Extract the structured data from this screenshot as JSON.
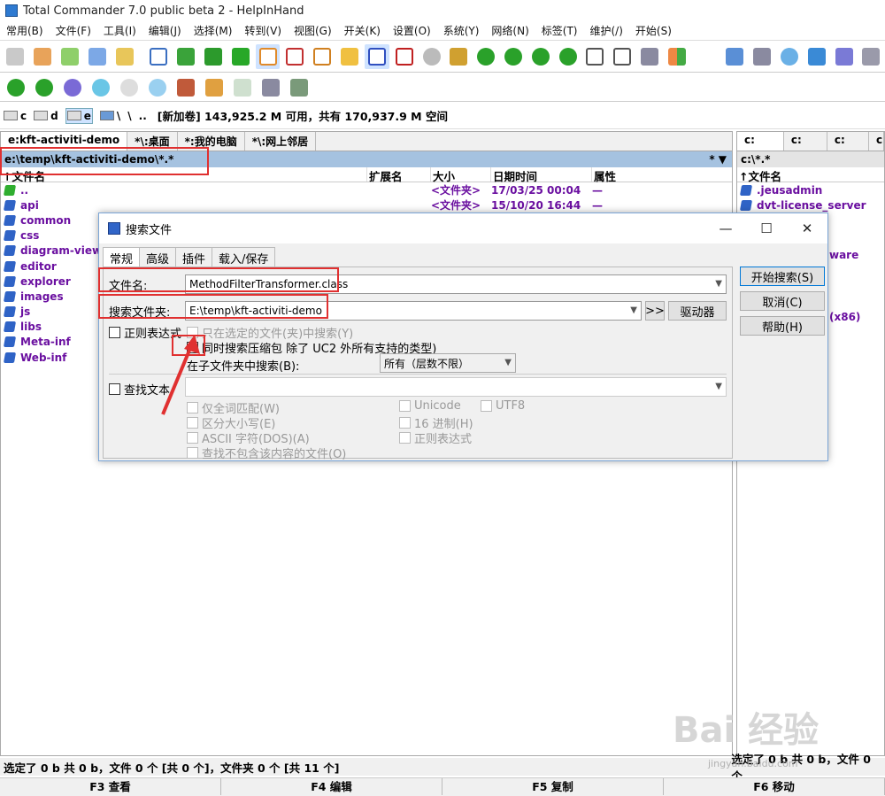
{
  "window": {
    "title": "Total Commander 7.0 public beta 2 - HelpInHand"
  },
  "menu": [
    "常用(B)",
    "文件(F)",
    "工具(I)",
    "编辑(J)",
    "选择(M)",
    "转到(V)",
    "视图(G)",
    "开关(K)",
    "设置(O)",
    "系统(Y)",
    "网络(N)",
    "标签(T)",
    "维护(/)",
    "开始(S)"
  ],
  "drivebar": {
    "drives": [
      "c",
      "d",
      "e"
    ],
    "extra": [
      "\\",
      "\\",
      ".."
    ],
    "volume_info": "[新加卷]  143,925.2 M 可用，共有 170,937.9 M 空间"
  },
  "left_panel": {
    "tabs": [
      "e:kft-activiti-demo",
      "*\\:桌面",
      "*:我的电脑",
      "*\\:网上邻居"
    ],
    "path": "e:\\temp\\kft-activiti-demo\\*.*",
    "path_right": "* ▼",
    "columns": [
      "↑文件名",
      "扩展名",
      "大小",
      "日期时间",
      "属性"
    ],
    "rows": [
      {
        "name": "..",
        "ext": "",
        "size": "<文件夹>",
        "date": "17/03/25 00:04",
        "attr": "—",
        "up": true
      },
      {
        "name": "api",
        "ext": "",
        "size": "<文件夹>",
        "date": "15/10/20 16:44",
        "attr": "—"
      },
      {
        "name": "common",
        "ext": "",
        "size": "",
        "date": "",
        "attr": ""
      },
      {
        "name": "css",
        "ext": "",
        "size": "",
        "date": "",
        "attr": ""
      },
      {
        "name": "diagram-viewe",
        "ext": "",
        "size": "",
        "date": "",
        "attr": ""
      },
      {
        "name": "editor",
        "ext": "",
        "size": "",
        "date": "",
        "attr": ""
      },
      {
        "name": "explorer",
        "ext": "",
        "size": "",
        "date": "",
        "attr": ""
      },
      {
        "name": "images",
        "ext": "",
        "size": "",
        "date": "",
        "attr": ""
      },
      {
        "name": "js",
        "ext": "",
        "size": "",
        "date": "",
        "attr": ""
      },
      {
        "name": "libs",
        "ext": "",
        "size": "",
        "date": "",
        "attr": ""
      },
      {
        "name": "Meta-inf",
        "ext": "",
        "size": "",
        "date": "",
        "attr": ""
      },
      {
        "name": "Web-inf",
        "ext": "",
        "size": "",
        "date": "",
        "attr": ""
      }
    ]
  },
  "right_panel": {
    "tabs": [
      "c:",
      "c:",
      "c:",
      "c"
    ],
    "path": "c:\\*.*",
    "column": "↑文件名",
    "rows": [
      ".jeusadmin",
      "dvt-license_server"
    ],
    "partials": [
      "ware",
      "(x86)"
    ]
  },
  "dialog": {
    "title": "搜索文件",
    "tabs": [
      "常规",
      "高级",
      "插件",
      "载入/保存"
    ],
    "filename_label": "文件名:",
    "filename_value": "MethodFilterTransformer.class",
    "folder_label": "搜索文件夹:",
    "folder_value": "E:\\temp\\kft-activiti-demo",
    "browse_btn": ">>",
    "drives_btn": "驱动器",
    "regex_label": "正则表达式",
    "only_selected_label": "只在选定的文件(夹)中搜索(Y)",
    "archives_label": "同时搜索压缩包 除了 UC2 外所有支持的类型)",
    "subfolder_label": "在子文件夹中搜索(B):",
    "subfolder_value": "所有（层数不限）",
    "find_text_label": "查找文本",
    "whole_words": "仅全词匹配(W)",
    "case_sensitive": "区分大小写(E)",
    "ascii": "ASCII 字符(DOS)(A)",
    "not_containing": "查找不包含该内容的文件(O)",
    "unicode": "Unicode",
    "utf8": "UTF8",
    "hex": "16 进制(H)",
    "regex2": "正则表达式",
    "start_btn": "开始搜索(S)",
    "cancel_btn": "取消(C)",
    "help_btn": "帮助(H)"
  },
  "status": {
    "left": "选定了 0 b 共 0 b，文件 0 个 [共 0 个]，文件夹 0 个 [共 11 个]",
    "right": "选定了 0 b 共 0 b，文件 0 个"
  },
  "fkeys": [
    "F3 查看",
    "F4 编辑",
    "F5 复制",
    "F6 移动"
  ],
  "watermark": {
    "text": "Bai 经验",
    "sub": "jingyan.baidu.com"
  }
}
